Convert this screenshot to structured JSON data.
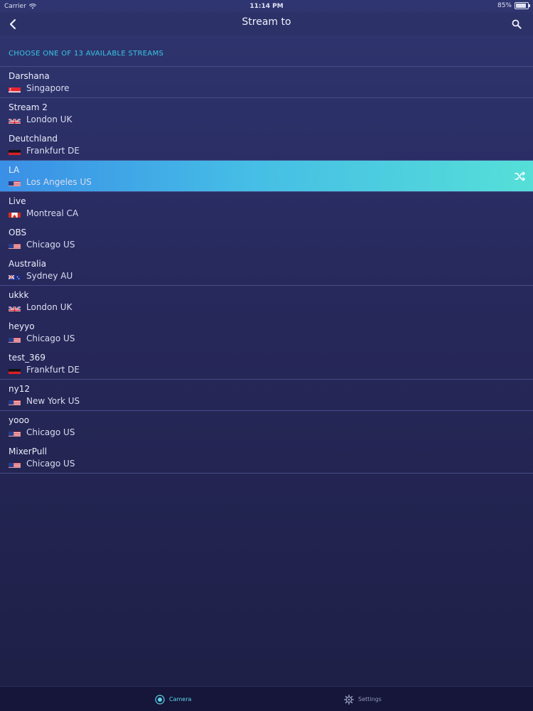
{
  "status_bar": {
    "carrier": "Carrier",
    "time": "11:14 PM",
    "battery": "85%",
    "battery_level": 0.85
  },
  "nav": {
    "title": "Stream to",
    "back_icon": "chevron-left-icon",
    "search_icon": "search-icon"
  },
  "section": {
    "header": "CHOOSE ONE OF 13 AVAILABLE STREAMS"
  },
  "streams": [
    {
      "name": "Darshana",
      "location": "Singapore",
      "flag": "sg"
    },
    {
      "name": "Stream 2",
      "location": "London UK",
      "flag": "uk"
    },
    {
      "name": "Deutchland",
      "location": "Frankfurt DE",
      "flag": "de"
    },
    {
      "name": "LA",
      "location": "Los Angeles US",
      "flag": "us",
      "selected": true
    },
    {
      "name": "Live",
      "location": "Montreal CA",
      "flag": "ca"
    },
    {
      "name": "OBS",
      "location": "Chicago US",
      "flag": "us"
    },
    {
      "name": "Australia",
      "location": "Sydney AU",
      "flag": "au"
    },
    {
      "name": "ukkk",
      "location": "London UK",
      "flag": "uk"
    },
    {
      "name": "heyyo",
      "location": "Chicago US",
      "flag": "us"
    },
    {
      "name": "test_369",
      "location": "Frankfurt DE",
      "flag": "de"
    },
    {
      "name": "ny12",
      "location": "New York US",
      "flag": "us"
    },
    {
      "name": "yooo",
      "location": "Chicago US",
      "flag": "us"
    },
    {
      "name": "MixerPull",
      "location": "Chicago US",
      "flag": "us"
    }
  ],
  "tabs": [
    {
      "label": "Camera",
      "icon": "camera-icon",
      "active": true
    },
    {
      "label": "Settings",
      "icon": "gear-icon",
      "active": false
    }
  ],
  "colors": {
    "accent": "#38c6e6",
    "selected_start": "#3a8fe6",
    "selected_end": "#55dfd8",
    "background": "#27295c"
  }
}
